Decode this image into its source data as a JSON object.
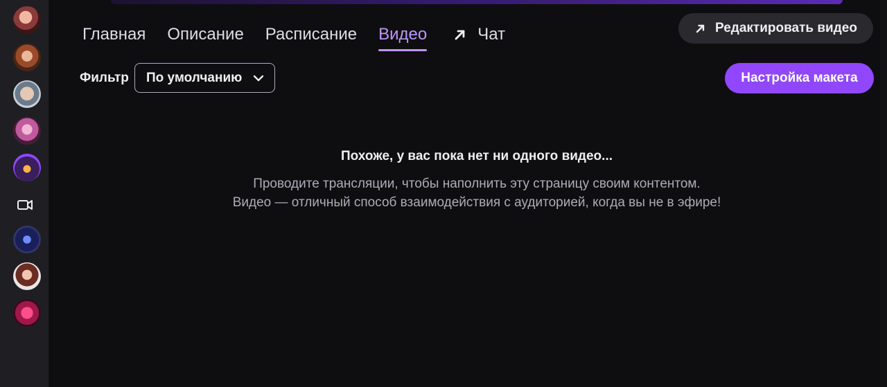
{
  "sidebar": {
    "channels": [
      {
        "icon": "avatar"
      },
      {
        "icon": "avatar"
      },
      {
        "icon": "avatar"
      },
      {
        "icon": "avatar"
      },
      {
        "icon": "avatar"
      },
      {
        "icon": "video-camera-icon"
      },
      {
        "icon": "avatar"
      },
      {
        "icon": "avatar"
      },
      {
        "icon": "avatar"
      }
    ]
  },
  "tabs": [
    {
      "label": "Главная",
      "active": false
    },
    {
      "label": "Описание",
      "active": false
    },
    {
      "label": "Расписание",
      "active": false
    },
    {
      "label": "Видео",
      "active": true
    },
    {
      "label": "Чат",
      "active": false,
      "icon": "external-arrow-icon"
    }
  ],
  "header": {
    "edit_video_label": "Редактировать видео"
  },
  "filter": {
    "label": "Фильтр",
    "selected": "По умолчанию"
  },
  "layout_button_label": "Настройка макета",
  "empty_state": {
    "title": "Похоже, у вас пока нет ни одного видео...",
    "line1": "Проводите трансляции, чтобы наполнить эту страницу своим контентом.",
    "line2": "Видео — отличный способ взаимодействия с аудиторией, когда вы не в эфире!"
  },
  "colors": {
    "accent": "#9147ff",
    "accent_text": "#bf94ff",
    "background": "#0e0e10",
    "sidebar": "#1f1f23"
  }
}
